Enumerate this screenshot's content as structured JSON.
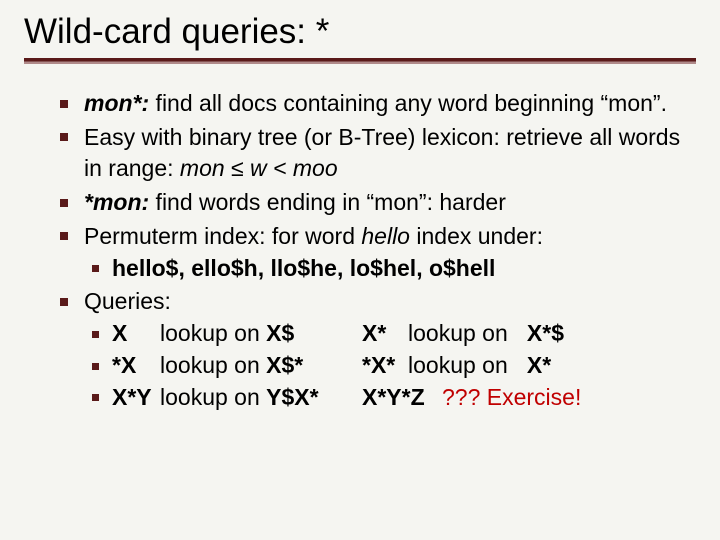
{
  "title": "Wild-card queries: *",
  "bullets": {
    "b1": {
      "lead": "mon*:",
      "rest": " find all docs containing any word beginning “mon”."
    },
    "b2": {
      "pre": "Easy with binary tree (or B-Tree) lexicon: retrieve all words in range: ",
      "range": "mon ≤ w < moo"
    },
    "b3": {
      "lead": "*mon:",
      "rest": " find words ending in “mon”: harder"
    },
    "b4": {
      "pre": "Permuterm index: for word ",
      "word": "hello",
      "post": " index under:",
      "sub": "hello$, ello$h, llo$he, lo$hel, o$hell"
    },
    "b5": {
      "label": "Queries:",
      "rows": [
        {
          "q1": "X",
          "l1": "lookup on ",
          "t1": "X$",
          "q2": "X*",
          "l2": "lookup on",
          "t2": "X*$"
        },
        {
          "q1": "*X",
          "l1": "lookup on ",
          "t1": "X$*",
          "q2": "*X*",
          "l2": "lookup on",
          "t2": "X*"
        },
        {
          "q1": "X*Y",
          "l1": "lookup on ",
          "t1": "Y$X*",
          "q2": "X*Y*Z",
          "ex": "??? Exercise!"
        }
      ]
    }
  }
}
